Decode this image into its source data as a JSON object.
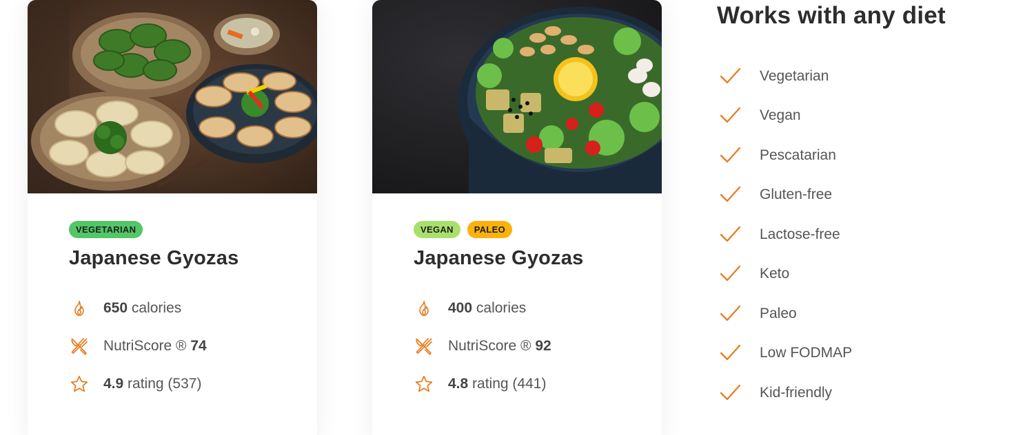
{
  "accent_color": "#e87d1e",
  "cards": [
    {
      "image": "gyoza-dumplings-photo",
      "tags": [
        {
          "label": "VEGETARIAN",
          "color": "#51c766"
        }
      ],
      "title": "Japanese Gyozas",
      "calories_value": "650",
      "calories_label": "calories",
      "nutri_label": "NutriScore ®",
      "nutri_value": "74",
      "rating_value": "4.9",
      "rating_label": "rating (537)"
    },
    {
      "image": "salad-bowl-photo",
      "tags": [
        {
          "label": "VEGAN",
          "color": "#a9e06c"
        },
        {
          "label": "PALEO",
          "color": "#fbb10c"
        }
      ],
      "title": "Japanese Gyozas",
      "calories_value": "400",
      "calories_label": "calories",
      "nutri_label": "NutriScore ®",
      "nutri_value": "92",
      "rating_value": "4.8",
      "rating_label": "rating (441)"
    }
  ],
  "diets": {
    "title": "Works with any diet",
    "items": [
      "Vegetarian",
      "Vegan",
      "Pescatarian",
      "Gluten-free",
      "Lactose-free",
      "Keto",
      "Paleo",
      "Low FODMAP",
      "Kid-friendly"
    ]
  }
}
